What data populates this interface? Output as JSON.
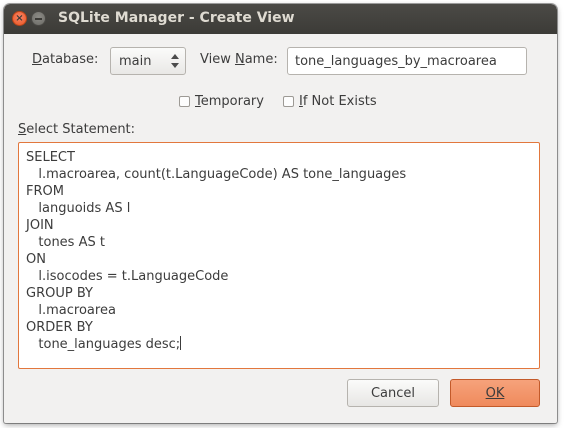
{
  "window": {
    "title": "SQLite Manager - Create View",
    "close_glyph": "×"
  },
  "form": {
    "database_label": "Database:",
    "database_value": "main",
    "view_name_label": "View Name:",
    "view_name_value": "tone_languages_by_macroarea",
    "temporary_label": "Temporary",
    "temporary_checked": false,
    "if_not_exists_label": "If Not Exists",
    "if_not_exists_checked": false,
    "select_statement_label": "Select Statement:"
  },
  "sql": {
    "lines": [
      "SELECT",
      "   l.macroarea, count(t.LanguageCode) AS tone_languages",
      "FROM",
      "   languoids AS l",
      "JOIN",
      "   tones AS t",
      "ON",
      "   l.isocodes = t.LanguageCode",
      "GROUP BY",
      "   l.macroarea",
      "ORDER BY",
      "   tone_languages desc;"
    ]
  },
  "buttons": {
    "cancel_label": "Cancel",
    "ok_label": "OK"
  },
  "colors": {
    "titlebar": "#3c3b37",
    "accent_orange": "#e2773d",
    "ok_button": "#ef8a5c",
    "close_button": "#e9541f"
  },
  "icons": {
    "close": "close-icon",
    "minimize": "minimize-icon",
    "spin_up": "chevron-up-icon",
    "spin_down": "chevron-down-icon"
  }
}
